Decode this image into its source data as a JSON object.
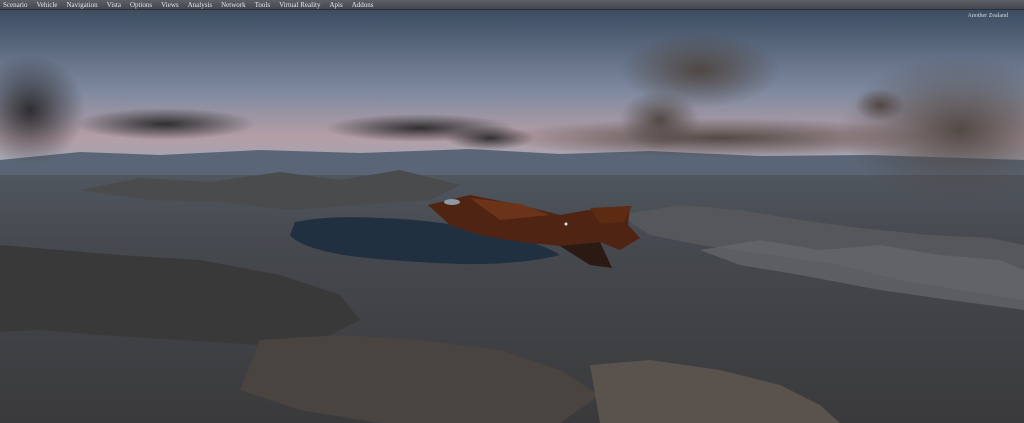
{
  "menu": {
    "items": [
      "Scenario",
      "Vehicle",
      "Navigation",
      "Vista",
      "Options",
      "Views",
      "Analysis",
      "Network",
      "Tools",
      "Virtual Reality",
      "Apis",
      "Addons"
    ]
  },
  "hud": {
    "top_right": "Another Zealand"
  },
  "scene": {
    "description_icon": "flight-sim-viewport",
    "sky_top": "#3f4f63",
    "sky_bottom": "#b8a0a8",
    "terrain": "#3e3f42",
    "lake": "#1f2f3e",
    "aircraft": "#5a2a14"
  }
}
